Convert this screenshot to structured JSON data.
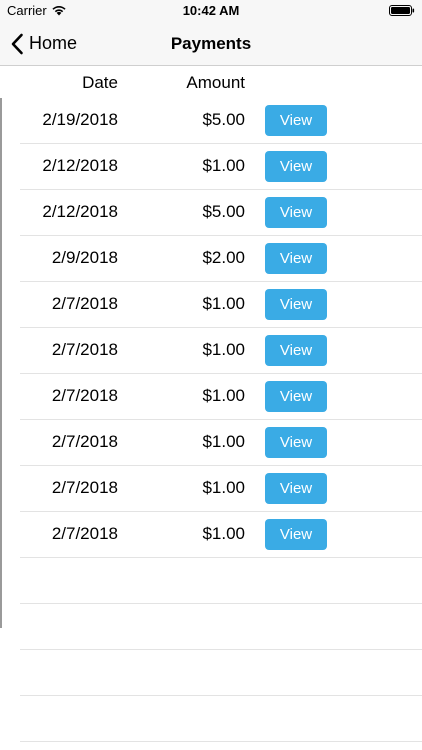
{
  "status_bar": {
    "carrier": "Carrier",
    "time": "10:42 AM"
  },
  "nav": {
    "back_label": "Home",
    "title": "Payments"
  },
  "table": {
    "headers": {
      "date": "Date",
      "amount": "Amount"
    },
    "rows": [
      {
        "date": "2/19/2018",
        "amount": "$5.00",
        "action": "View"
      },
      {
        "date": "2/12/2018",
        "amount": "$1.00",
        "action": "View"
      },
      {
        "date": "2/12/2018",
        "amount": "$5.00",
        "action": "View"
      },
      {
        "date": "2/9/2018",
        "amount": "$2.00",
        "action": "View"
      },
      {
        "date": "2/7/2018",
        "amount": "$1.00",
        "action": "View"
      },
      {
        "date": "2/7/2018",
        "amount": "$1.00",
        "action": "View"
      },
      {
        "date": "2/7/2018",
        "amount": "$1.00",
        "action": "View"
      },
      {
        "date": "2/7/2018",
        "amount": "$1.00",
        "action": "View"
      },
      {
        "date": "2/7/2018",
        "amount": "$1.00",
        "action": "View"
      },
      {
        "date": "2/7/2018",
        "amount": "$1.00",
        "action": "View"
      }
    ]
  },
  "colors": {
    "accent": "#3aabe5",
    "bar_background": "#f7f7f7",
    "separator": "#e3e3e3"
  },
  "icons": {
    "wifi": "wifi-icon",
    "battery": "battery-icon",
    "back": "chevron-left-icon"
  }
}
